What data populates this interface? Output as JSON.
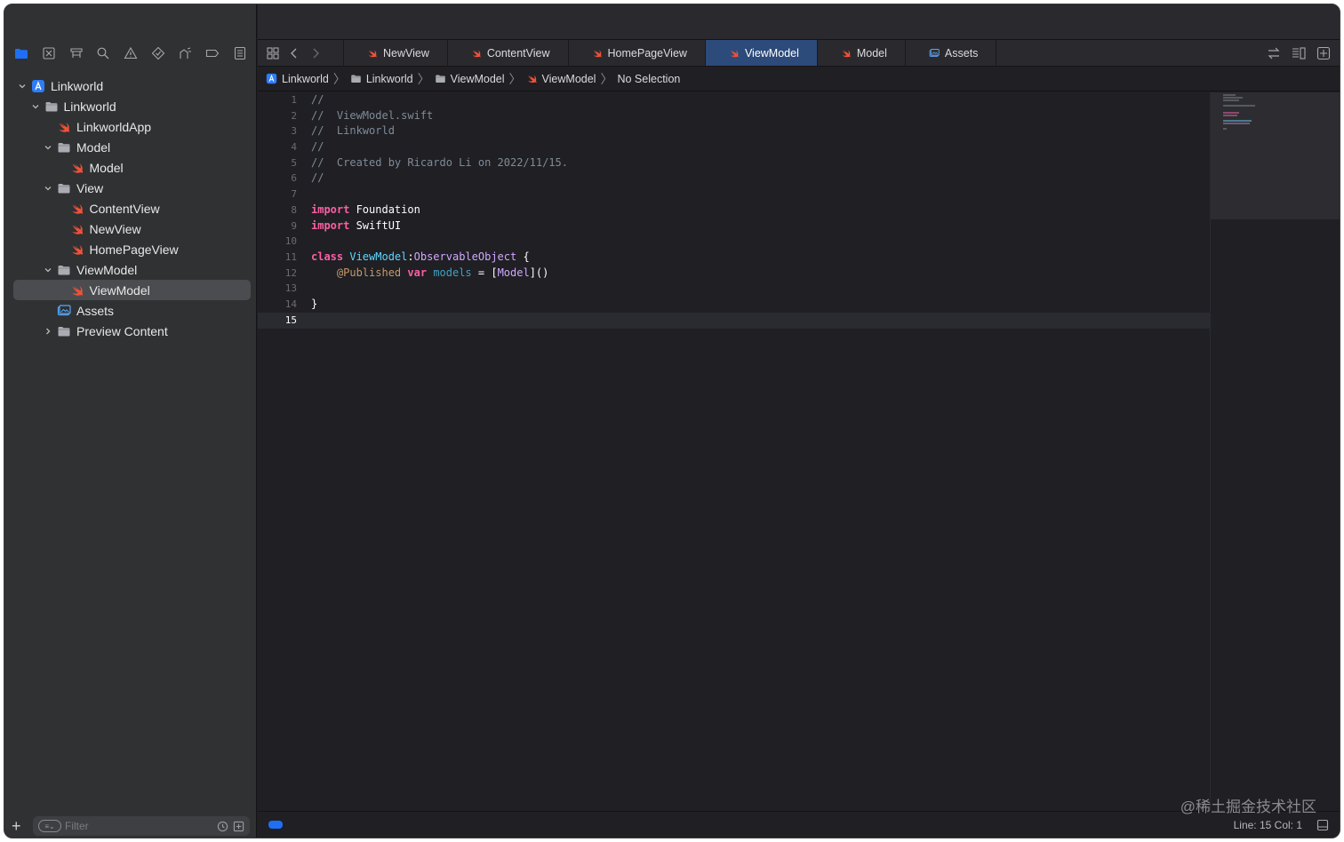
{
  "colors": {
    "accent": "#1e6ff5",
    "swift_icon": "#f05138",
    "folder": "#a9acb1",
    "active_tab": "#2c4a7a"
  },
  "sidebar": {
    "nav_icons": [
      "folder-icon",
      "source-control-icon",
      "symbol-icon",
      "search-icon",
      "warning-icon",
      "test-icon",
      "debug-icon",
      "breakpoint-icon",
      "report-icon"
    ],
    "tree": [
      {
        "label": "Linkworld",
        "depth": 0,
        "kind": "project",
        "expanded": true
      },
      {
        "label": "Linkworld",
        "depth": 1,
        "kind": "folder",
        "expanded": true
      },
      {
        "label": "LinkworldApp",
        "depth": 2,
        "kind": "swift"
      },
      {
        "label": "Model",
        "depth": 2,
        "kind": "folder",
        "expanded": true
      },
      {
        "label": "Model",
        "depth": 3,
        "kind": "swift"
      },
      {
        "label": "View",
        "depth": 2,
        "kind": "folder",
        "expanded": true
      },
      {
        "label": "ContentView",
        "depth": 3,
        "kind": "swift"
      },
      {
        "label": "NewView",
        "depth": 3,
        "kind": "swift"
      },
      {
        "label": "HomePageView",
        "depth": 3,
        "kind": "swift"
      },
      {
        "label": "ViewModel",
        "depth": 2,
        "kind": "folder",
        "expanded": true
      },
      {
        "label": "ViewModel",
        "depth": 3,
        "kind": "swift",
        "selected": true
      },
      {
        "label": "Assets",
        "depth": 2,
        "kind": "assets"
      },
      {
        "label": "Preview Content",
        "depth": 2,
        "kind": "folder",
        "expanded": false
      }
    ],
    "filter_placeholder": "Filter"
  },
  "tabs": [
    {
      "label": "NewView",
      "icon": "swift-icon"
    },
    {
      "label": "ContentView",
      "icon": "swift-icon"
    },
    {
      "label": "HomePageView",
      "icon": "swift-icon"
    },
    {
      "label": "ViewModel",
      "icon": "swift-icon",
      "active": true
    },
    {
      "label": "Model",
      "icon": "swift-icon"
    },
    {
      "label": "Assets",
      "icon": "assets-icon"
    }
  ],
  "breadcrumb": [
    {
      "label": "Linkworld",
      "icon": "project-icon"
    },
    {
      "label": "Linkworld",
      "icon": "folder-icon"
    },
    {
      "label": "ViewModel",
      "icon": "folder-icon"
    },
    {
      "label": "ViewModel",
      "icon": "swift-icon"
    },
    {
      "label": "No Selection",
      "icon": ""
    }
  ],
  "code_lines": [
    [
      [
        "c-com",
        "//"
      ]
    ],
    [
      [
        "c-com",
        "//  ViewModel.swift"
      ]
    ],
    [
      [
        "c-com",
        "//  Linkworld"
      ]
    ],
    [
      [
        "c-com",
        "//"
      ]
    ],
    [
      [
        "c-com",
        "//  Created by Ricardo Li on 2022/11/15."
      ]
    ],
    [
      [
        "c-com",
        "//"
      ]
    ],
    [],
    [
      [
        "c-kw",
        "import"
      ],
      [
        "c-plain",
        " Foundation"
      ]
    ],
    [
      [
        "c-kw",
        "import"
      ],
      [
        "c-plain",
        " SwiftUI"
      ]
    ],
    [],
    [
      [
        "c-kw",
        "class"
      ],
      [
        "c-plain",
        " "
      ],
      [
        "c-type",
        "ViewModel"
      ],
      [
        "c-plain",
        ":"
      ],
      [
        "c-type2",
        "ObservableObject"
      ],
      [
        "c-plain",
        " {"
      ]
    ],
    [
      [
        "c-plain",
        "    "
      ],
      [
        "c-attr",
        "@Published"
      ],
      [
        "c-plain",
        " "
      ],
      [
        "c-kw",
        "var"
      ],
      [
        "c-plain",
        " "
      ],
      [
        "c-var",
        "models"
      ],
      [
        "c-plain",
        " = ["
      ],
      [
        "c-type2",
        "Model"
      ],
      [
        "c-plain",
        "]()"
      ]
    ],
    [],
    [
      [
        "c-plain",
        "}"
      ]
    ],
    []
  ],
  "current_line": 15,
  "status": {
    "position": "Line: 15  Col: 1"
  },
  "watermark": "@稀土掘金技术社区"
}
